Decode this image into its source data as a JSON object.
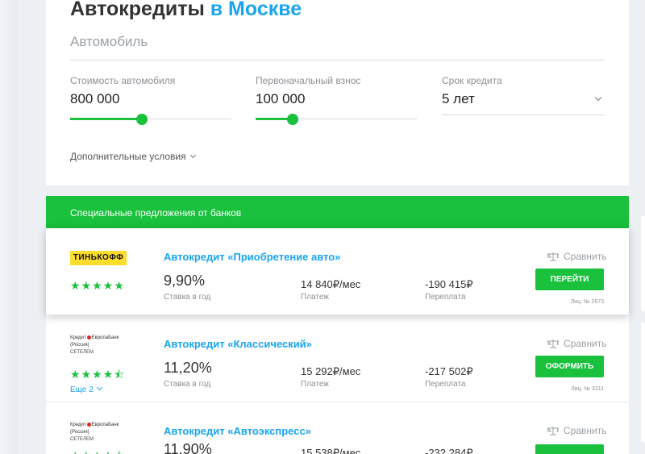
{
  "page": {
    "title_main": "Автокредиты",
    "title_city": " в Москве"
  },
  "filters": {
    "car_placeholder": "Автомобиль",
    "price": {
      "label": "Стоимость автомобиля",
      "value": "800 000",
      "slider_fraction": 0.45
    },
    "down_payment": {
      "label": "Первоначальный взнос",
      "value": "100 000",
      "slider_fraction": 0.23
    },
    "term": {
      "label": "Срок кредита",
      "value": "5 лет"
    },
    "more_conditions": "Дополнительные условия"
  },
  "offers_header": "Специальные предложения от банков",
  "offers": [
    {
      "bank_logo_text": "ТИНЬКОФФ",
      "rating_stars": "★★★★★",
      "name": "Автокредит «Приобретение авто»",
      "rate": "9,90%",
      "rate_label": "Ставка в год",
      "payment": "14 840₽/мес",
      "payment_label": "Платеж",
      "overpay": "-190 415₽",
      "overpay_label": "Переплата",
      "compare_label": "Сравнить",
      "button_label": "ПЕРЕЙТИ",
      "license": "Лиц. № 2673"
    },
    {
      "bank_logo_text": "Кредит",
      "bank_logo_name": "ЕвропаБанк (Россия)",
      "bank_logo_sub": "СЕТЕЛЕМ",
      "rating_stars": "★★★★⯪",
      "more_label": "Еще 2",
      "name": "Автокредит «Классический»",
      "rate": "11,20%",
      "rate_label": "Ставка в год",
      "payment": "15 292₽/мес",
      "payment_label": "Платеж",
      "overpay": "-217 502₽",
      "overpay_label": "Переплата",
      "compare_label": "Сравнить",
      "button_label": "ОФОРМИТЬ",
      "license": "Лиц. № 3311"
    },
    {
      "bank_logo_text": "Кредит",
      "bank_logo_name": "ЕвропаБанк (Россия)",
      "bank_logo_sub": "СЕТЕЛЕМ",
      "rating_stars": "★★★★⯪",
      "name": "Автокредит «Автоэкспресс»",
      "rate": "11,90%",
      "payment": "15 538₽/мес",
      "overpay": "-232 284₽",
      "compare_label": "Сравнить"
    }
  ],
  "colors": {
    "accent_green": "#19c13c",
    "link_blue": "#1aa4f0",
    "tinkoff_yellow": "#ffdd2d"
  }
}
